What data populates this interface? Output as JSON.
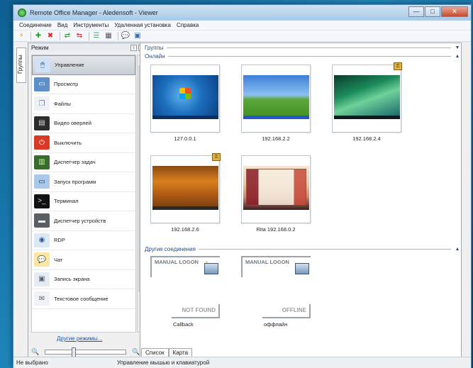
{
  "window": {
    "title": "Remote Office Manager - Aledensoft - Viewer",
    "buttons": {
      "minimize": "—",
      "maximize": "□",
      "close": "✕"
    }
  },
  "menu": [
    "Соединение",
    "Вид",
    "Инструменты",
    "Удаленная установка",
    "Справка"
  ],
  "toolbar": {
    "icons": [
      "flash-icon",
      "add-icon",
      "delete-icon",
      "refresh-icon",
      "refresh2-icon",
      "list-view-icon",
      "grid-view-icon",
      "chat-icon",
      "screen-icon"
    ]
  },
  "left_tabs": {
    "groups": "Группы"
  },
  "left_panel": {
    "header": "Режим",
    "pin": "ᛝ",
    "close": "×",
    "modes": [
      {
        "label": "Управление",
        "icon": "mouse-icon",
        "selected": true
      },
      {
        "label": "Просмотр",
        "icon": "monitor-icon",
        "selected": false
      },
      {
        "label": "Файлы",
        "icon": "files-icon",
        "selected": false
      },
      {
        "label": "Видео оверлей",
        "icon": "film-icon",
        "selected": false
      },
      {
        "label": "Выключить",
        "icon": "power-icon",
        "selected": false
      },
      {
        "label": "Диспетчер задач",
        "icon": "task-manager-icon",
        "selected": false
      },
      {
        "label": "Запуск программ",
        "icon": "run-icon",
        "selected": false
      },
      {
        "label": "Терминал",
        "icon": "terminal-icon",
        "selected": false
      },
      {
        "label": "Диспетчер устройств",
        "icon": "device-icon",
        "selected": false
      },
      {
        "label": "RDP",
        "icon": "rdp-icon",
        "selected": false
      },
      {
        "label": "Чат",
        "icon": "chat-bubble-icon",
        "selected": false
      },
      {
        "label": "Запись экрана",
        "icon": "record-icon",
        "selected": false
      },
      {
        "label": "Текстовое сообщение",
        "icon": "message-icon",
        "selected": false
      }
    ],
    "other_modes": "Другие режимы...",
    "zoom": {
      "min_icon": "zoom-out-icon",
      "max_icon": "zoom-in-icon",
      "level": 0.35
    }
  },
  "sections": {
    "groups": "Группы",
    "online": "Онлайн",
    "other": "Другие соединения"
  },
  "hosts": [
    {
      "name": "127.0.0.1",
      "screen": "win7-desktop",
      "badge": false
    },
    {
      "name": "192.168.2.2",
      "screen": "xp-desktop",
      "badge": false
    },
    {
      "name": "192.168.2.4",
      "screen": "vista-desktop",
      "badge": true
    },
    {
      "name": "192.168.2.6",
      "screen": "autumn-desktop",
      "badge": true
    },
    {
      "name": "Rita 192.168.0.2",
      "screen": "browser-desktop",
      "badge": false
    }
  ],
  "other_connections": [
    {
      "logon": "MANUAL LOGON",
      "status": "NOT FOUND",
      "name": "Callback",
      "icon": "warning-icon"
    },
    {
      "logon": "MANUAL LOGON",
      "status": "OFFLINE",
      "name": "оффлайн",
      "icon": "computer-icon"
    }
  ],
  "bottom_tabs": [
    "Список",
    "Карта"
  ],
  "statusbar": {
    "left": "Не выбрано",
    "middle": "Управление мышью и клавиатурой"
  },
  "colors": {
    "section_header": "#274f86",
    "link": "#1a58b5",
    "desktop_bg": "#1f86b9"
  }
}
